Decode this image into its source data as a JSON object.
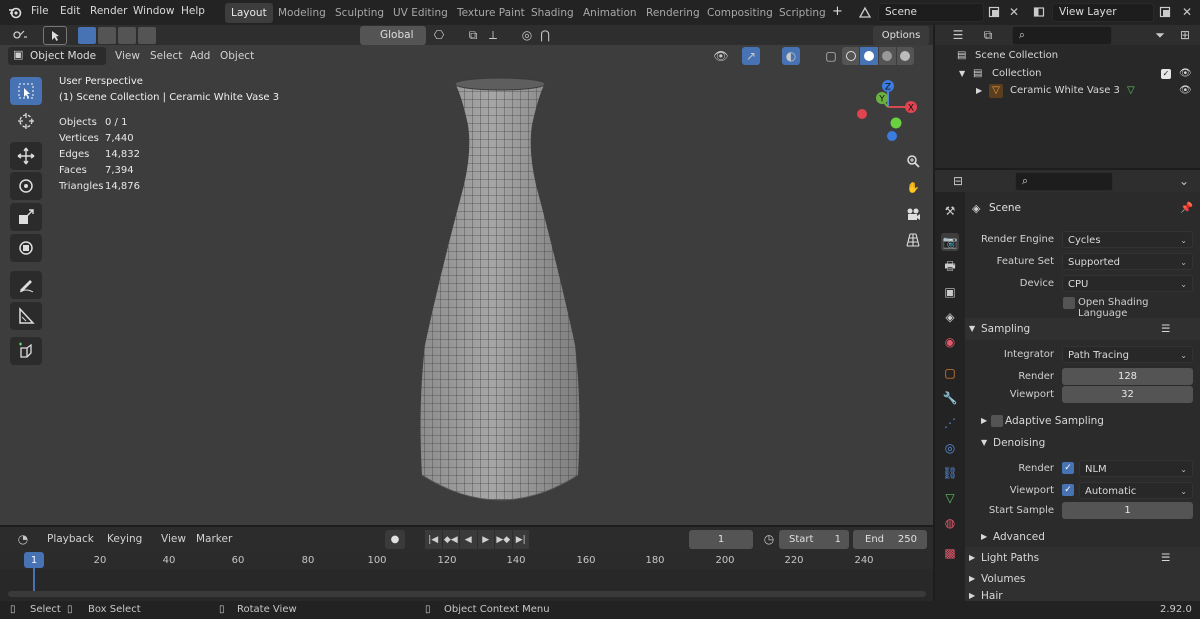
{
  "topbar": {
    "menus": [
      "File",
      "Edit",
      "Render",
      "Window",
      "Help"
    ],
    "workspaces": [
      "Layout",
      "Modeling",
      "Sculpting",
      "UV Editing",
      "Texture Paint",
      "Shading",
      "Animation",
      "Rendering",
      "Compositing",
      "Scripting"
    ],
    "active_workspace": "Layout",
    "add_tab": "+",
    "scene_name": "Scene",
    "view_layer": "View Layer"
  },
  "viewport": {
    "mode": "Object Mode",
    "menus": [
      "View",
      "Select",
      "Add",
      "Object"
    ],
    "transform_orientation": "Global",
    "options_label": "Options",
    "overlay_title": "User Perspective",
    "overlay_subtitle": "(1) Scene Collection | Ceramic White Vase 3",
    "stats": [
      {
        "label": "Objects",
        "value": "0 / 1"
      },
      {
        "label": "Vertices",
        "value": "7,440"
      },
      {
        "label": "Edges",
        "value": "14,832"
      },
      {
        "label": "Faces",
        "value": "7,394"
      },
      {
        "label": "Triangles",
        "value": "14,876"
      }
    ],
    "gizmo": {
      "z": "Z",
      "y": "Y",
      "x": "X"
    }
  },
  "timeline": {
    "menus": [
      "Playback",
      "Keying",
      "View",
      "Marker"
    ],
    "current_frame": "1",
    "start_label": "Start",
    "start": "1",
    "end_label": "End",
    "end": "250",
    "frame_labels": [
      "1",
      "20",
      "40",
      "60",
      "80",
      "100",
      "120",
      "140",
      "160",
      "180",
      "200",
      "220",
      "240"
    ]
  },
  "statusbar": {
    "select": "Select",
    "box_select": "Box Select",
    "rotate_view": "Rotate View",
    "context_menu": "Object Context Menu",
    "version": "2.92.0"
  },
  "outliner": {
    "scene_collection": "Scene Collection",
    "collection": "Collection",
    "object": "Ceramic White Vase 3"
  },
  "properties": {
    "context": "Scene",
    "render_engine_label": "Render Engine",
    "render_engine": "Cycles",
    "feature_set_label": "Feature Set",
    "feature_set": "Supported",
    "device_label": "Device",
    "device": "CPU",
    "osl_label": "Open Shading Language",
    "sampling_label": "Sampling",
    "integrator_label": "Integrator",
    "integrator": "Path Tracing",
    "render_label": "Render",
    "render_samples": "128",
    "viewport_label": "Viewport",
    "viewport_samples": "32",
    "adaptive_label": "Adaptive Sampling",
    "denoising_label": "Denoising",
    "denoise_render_label": "Render",
    "denoise_render": "NLM",
    "denoise_viewport_label": "Viewport",
    "denoise_viewport": "Automatic",
    "start_sample_label": "Start Sample",
    "start_sample": "1",
    "advanced_label": "Advanced",
    "light_paths_label": "Light Paths",
    "volumes_label": "Volumes",
    "hair_label": "Hair"
  }
}
